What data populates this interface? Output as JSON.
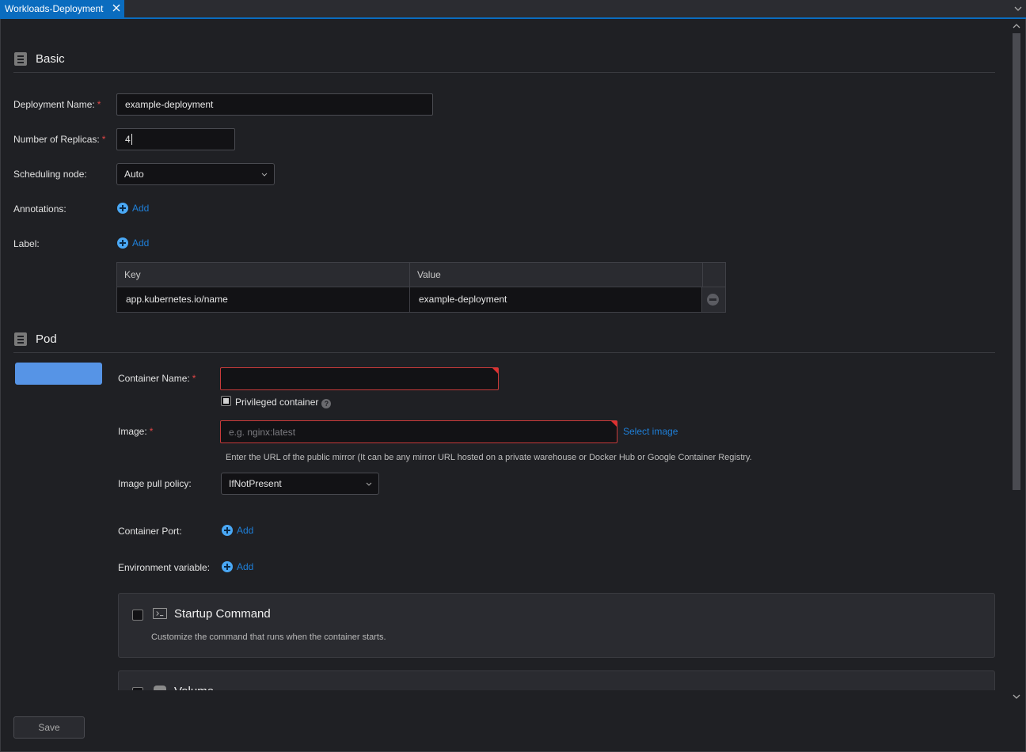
{
  "tab": {
    "title": "Workloads-Deployment",
    "close_icon": "close-icon"
  },
  "sections": {
    "basic": {
      "title": "Basic",
      "icon": "document-icon"
    },
    "pod": {
      "title": "Pod",
      "icon": "document-icon"
    }
  },
  "basic": {
    "deployment_name": {
      "label": "Deployment Name:",
      "required": "*",
      "value": "example-deployment"
    },
    "replicas": {
      "label": "Number of Replicas:",
      "required": "*",
      "value": "4"
    },
    "scheduling": {
      "label": "Scheduling node:",
      "selected": "Auto"
    },
    "annotations": {
      "label": "Annotations:",
      "add_label": "Add"
    },
    "label": {
      "label": "Label:",
      "add_label": "Add"
    },
    "label_table": {
      "headers": [
        "Key",
        "Value"
      ],
      "rows": [
        {
          "key": "app.kubernetes.io/name",
          "value": "example-deployment"
        }
      ]
    }
  },
  "pod": {
    "container_name": {
      "label": "Container Name:",
      "required": "*",
      "value": ""
    },
    "privileged": {
      "label": "Privileged container",
      "help": "?"
    },
    "image": {
      "label": "Image:",
      "required": "*",
      "placeholder": "e.g. nginx:latest",
      "select_link": "Select image",
      "hint": "Enter the URL of the public mirror (It can be any mirror URL hosted on a private warehouse or Docker Hub or Google Container Registry."
    },
    "pull_policy": {
      "label": "Image pull policy:",
      "selected": "IfNotPresent"
    },
    "container_port": {
      "label": "Container Port:",
      "add_label": "Add"
    },
    "env_var": {
      "label": "Environment variable:",
      "add_label": "Add"
    },
    "cards": [
      {
        "title": "Startup Command",
        "description": "Customize the command that runs when the container starts.",
        "icon": "terminal-icon"
      },
      {
        "title": "Volume",
        "description": "",
        "icon": "storage-icon"
      }
    ]
  },
  "footer": {
    "save_label": "Save"
  }
}
